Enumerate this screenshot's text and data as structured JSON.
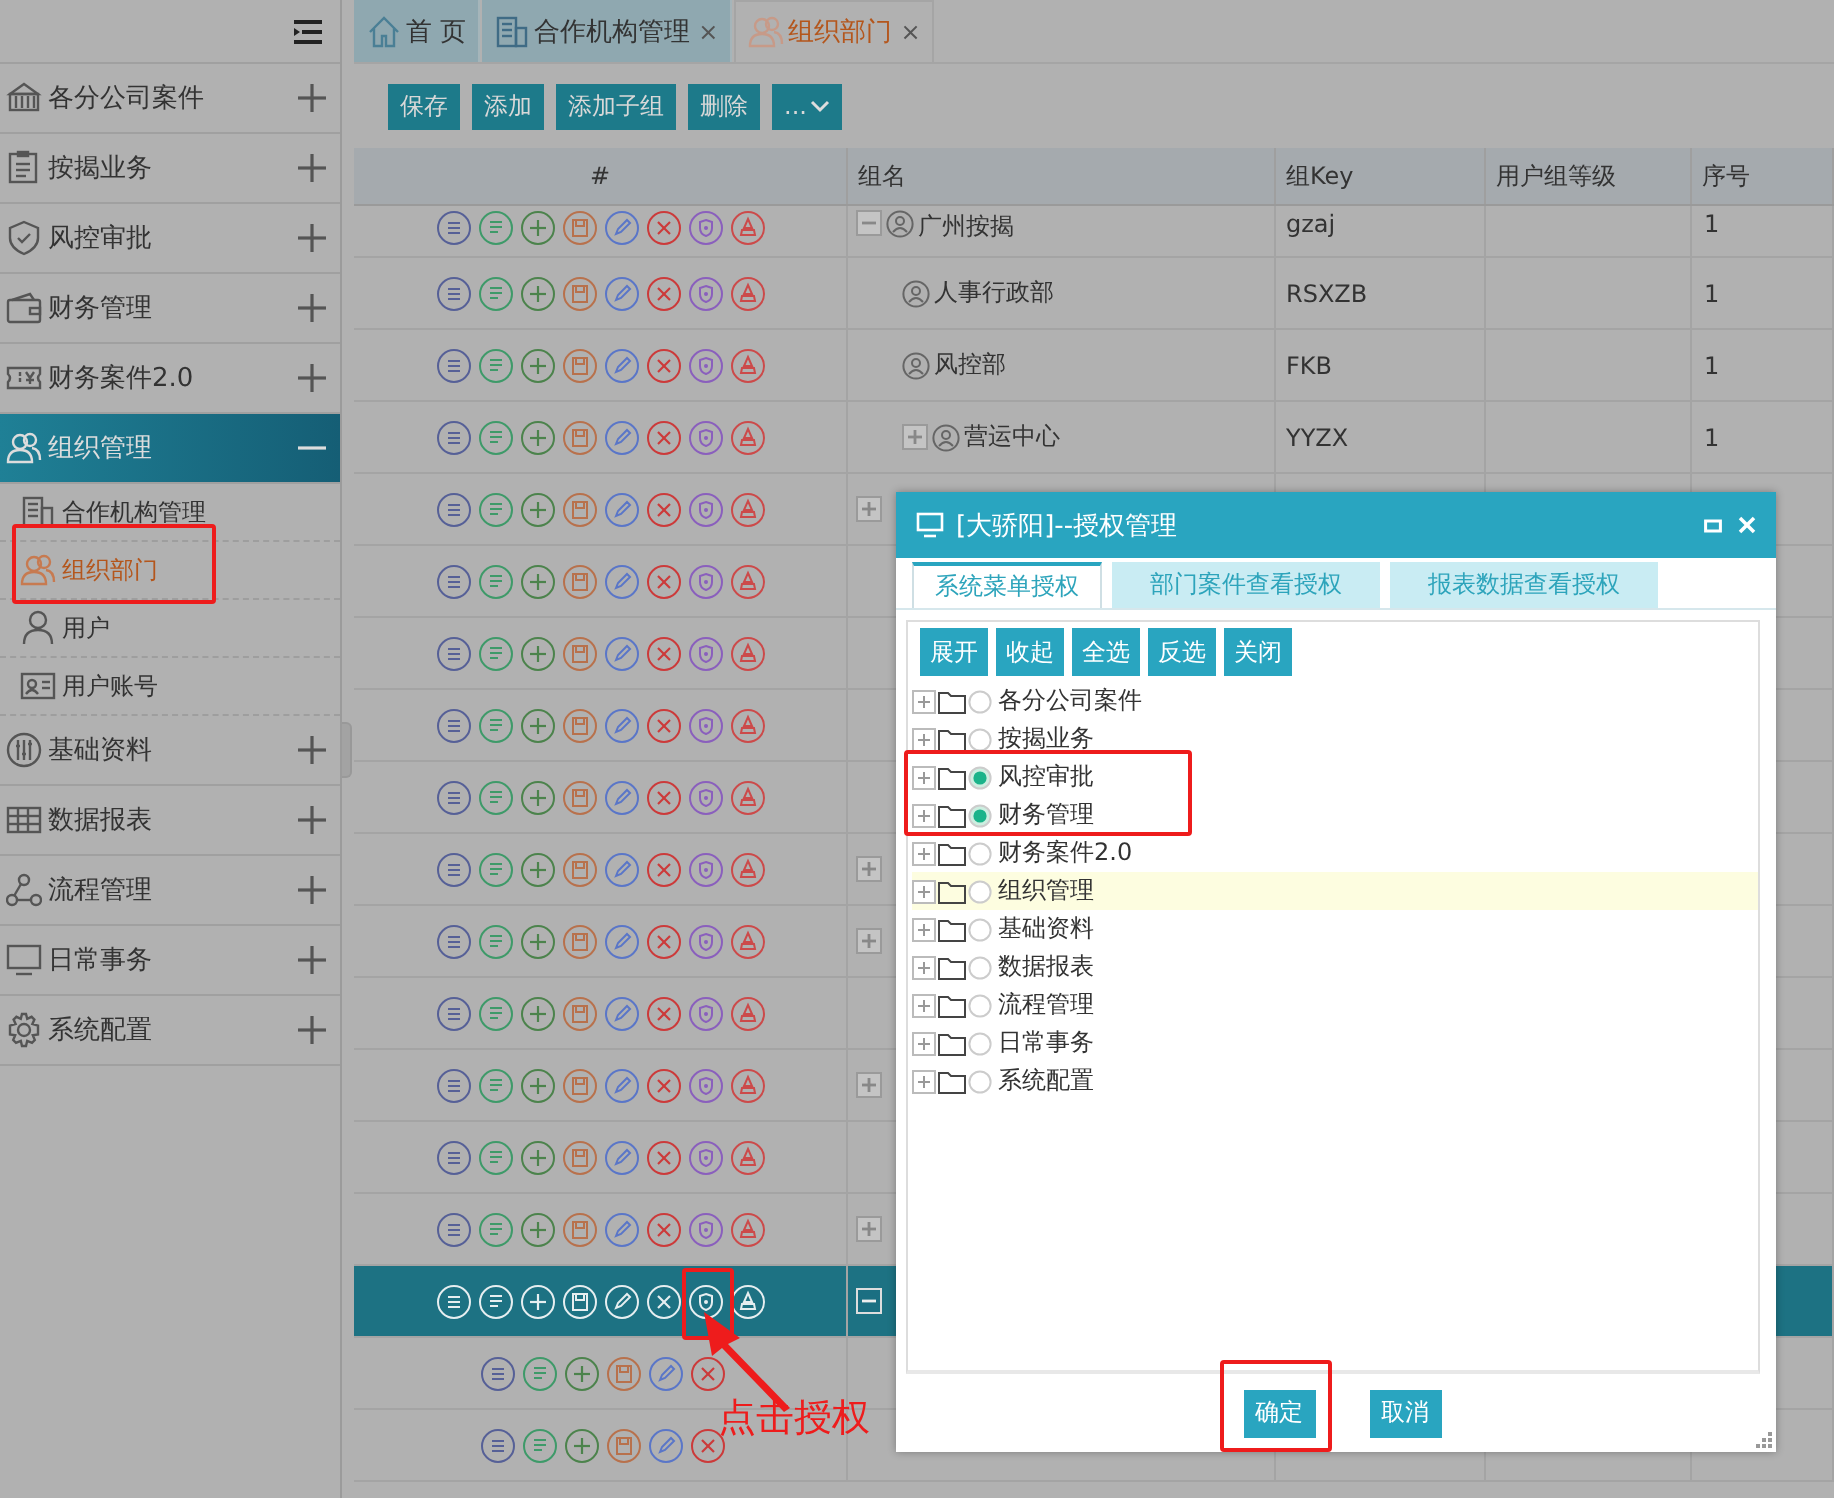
{
  "sidebar": {
    "items": [
      {
        "label": "各分公司案件",
        "expanded": false
      },
      {
        "label": "按揭业务",
        "expanded": false
      },
      {
        "label": "风控审批",
        "expanded": false
      },
      {
        "label": "财务管理",
        "expanded": false
      },
      {
        "label": "财务案件2.0",
        "expanded": false
      },
      {
        "label": "组织管理",
        "expanded": true,
        "children": [
          {
            "label": "合作机构管理",
            "selected": false
          },
          {
            "label": "组织部门",
            "selected": true
          },
          {
            "label": "用户",
            "selected": false
          },
          {
            "label": "用户账号",
            "selected": false
          }
        ]
      },
      {
        "label": "基础资料",
        "expanded": false
      },
      {
        "label": "数据报表",
        "expanded": false
      },
      {
        "label": "流程管理",
        "expanded": false
      },
      {
        "label": "日常事务",
        "expanded": false
      },
      {
        "label": "系统配置",
        "expanded": false
      }
    ]
  },
  "tabs": [
    {
      "label": "首 页",
      "selected": false,
      "closable": false
    },
    {
      "label": "合作机构管理",
      "selected": false,
      "closable": true
    },
    {
      "label": "组织部门",
      "selected": true,
      "closable": true
    }
  ],
  "close_mark": "×",
  "toolbar": {
    "buttons": [
      "保存",
      "添加",
      "添加子组",
      "删除"
    ],
    "more": "..."
  },
  "table": {
    "columns": [
      "#",
      "组名",
      "组Key",
      "用户组等级",
      "序号"
    ],
    "rows": [
      {
        "name": "广州按揭",
        "key": "gzaj",
        "order": "1",
        "expandable": true,
        "expanded": true,
        "indent": false,
        "kind": "full",
        "selected": false
      },
      {
        "name": "人事行政部",
        "key": "RSXZB",
        "order": "1",
        "expandable": false,
        "indent": true,
        "kind": "full",
        "selected": false
      },
      {
        "name": "风控部",
        "key": "FKB",
        "order": "1",
        "expandable": false,
        "indent": true,
        "kind": "full",
        "selected": false
      },
      {
        "name": "营运中心",
        "key": "YYZX",
        "order": "1",
        "expandable": true,
        "expanded": false,
        "indent": true,
        "kind": "full",
        "selected": false
      },
      {
        "expandable": true,
        "expanded": false,
        "kind": "full",
        "selected": false
      },
      {
        "kind": "full",
        "selected": false
      },
      {
        "kind": "full",
        "selected": false
      },
      {
        "kind": "full",
        "selected": false
      },
      {
        "kind": "full",
        "selected": false
      },
      {
        "expandable": true,
        "expanded": false,
        "kind": "full",
        "selected": false
      },
      {
        "expandable": true,
        "expanded": false,
        "kind": "full",
        "selected": false
      },
      {
        "kind": "full",
        "selected": false
      },
      {
        "expandable": true,
        "expanded": false,
        "kind": "full",
        "selected": false
      },
      {
        "kind": "full",
        "selected": false
      },
      {
        "expandable": true,
        "expanded": false,
        "kind": "full",
        "selected": false
      },
      {
        "expandable": true,
        "expanded": true,
        "kind": "full",
        "selected": true
      },
      {
        "kind": "basic",
        "selected": false
      },
      {
        "kind": "basic",
        "selected": false
      }
    ]
  },
  "dialog": {
    "title": "[大骄阳]--授权管理",
    "tabs": [
      {
        "label": "系统菜单授权",
        "selected": true
      },
      {
        "label": "部门案件查看授权",
        "selected": false
      },
      {
        "label": "报表数据查看授权",
        "selected": false
      }
    ],
    "buttons": [
      "展开",
      "收起",
      "全选",
      "反选",
      "关闭"
    ],
    "tree": [
      {
        "label": "各分公司案件",
        "checked": false,
        "highlighted": false
      },
      {
        "label": "按揭业务",
        "checked": false,
        "highlighted": false
      },
      {
        "label": "风控审批",
        "checked": true,
        "highlighted": false
      },
      {
        "label": "财务管理",
        "checked": true,
        "highlighted": false
      },
      {
        "label": "财务案件2.0",
        "checked": false,
        "highlighted": false
      },
      {
        "label": "组织管理",
        "checked": false,
        "highlighted": true
      },
      {
        "label": "基础资料",
        "checked": false,
        "highlighted": false
      },
      {
        "label": "数据报表",
        "checked": false,
        "highlighted": false
      },
      {
        "label": "流程管理",
        "checked": false,
        "highlighted": false
      },
      {
        "label": "日常事务",
        "checked": false,
        "highlighted": false
      },
      {
        "label": "系统配置",
        "checked": false,
        "highlighted": false
      }
    ],
    "footer": [
      "确定",
      "取消"
    ]
  },
  "annotation": {
    "text": "点击授权"
  }
}
